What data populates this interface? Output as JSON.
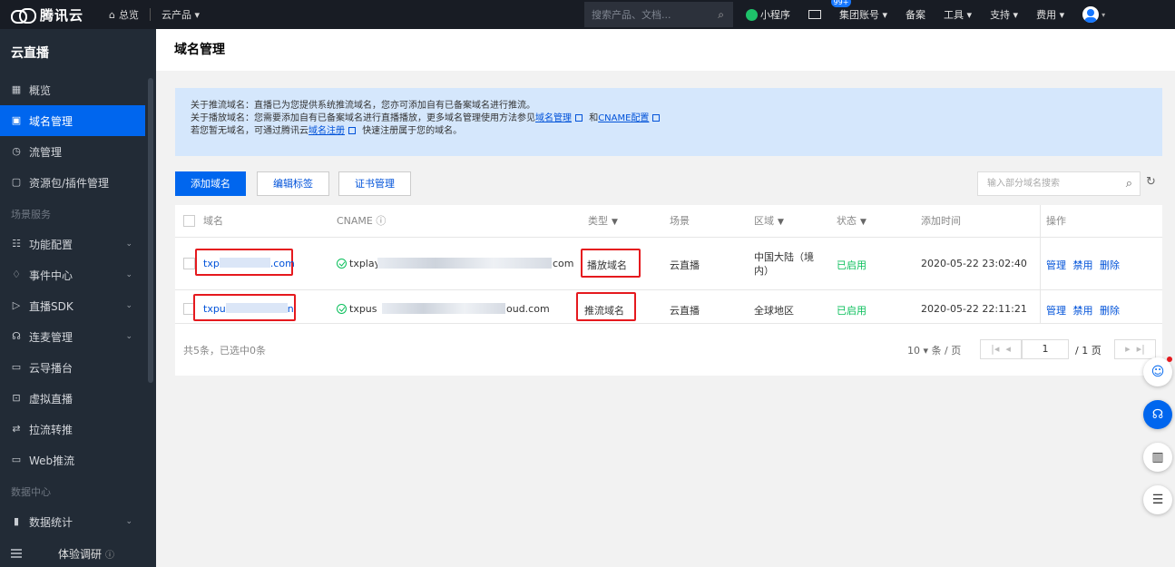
{
  "topbar": {
    "brand": "腾讯云",
    "home": "总览",
    "products": "云产品 ▾",
    "search_placeholder": "搜索产品、文档...",
    "mini_program": "小程序",
    "mail_badge": "99+",
    "group_account": "集团账号 ▾",
    "record": "备案",
    "tools": "工具 ▾",
    "support": "支持 ▾",
    "billing": "费用 ▾"
  },
  "sidebar": {
    "title": "云直播",
    "items": [
      {
        "label": "概览",
        "icon": "grid-icon"
      },
      {
        "label": "域名管理",
        "icon": "domain-icon"
      },
      {
        "label": "流管理",
        "icon": "stream-icon"
      },
      {
        "label": "资源包/插件管理",
        "icon": "package-icon"
      }
    ],
    "group1": "场景服务",
    "scene_items": [
      {
        "label": "功能配置",
        "icon": "settings-icon"
      },
      {
        "label": "事件中心",
        "icon": "bell-icon"
      },
      {
        "label": "直播SDK",
        "icon": "play-icon"
      },
      {
        "label": "连麦管理",
        "icon": "mic-icon"
      },
      {
        "label": "云导播台",
        "icon": "monitor-icon"
      },
      {
        "label": "虚拟直播",
        "icon": "virtual-icon"
      },
      {
        "label": "拉流转推",
        "icon": "swap-icon"
      },
      {
        "label": "Web推流",
        "icon": "web-icon"
      }
    ],
    "group2": "数据中心",
    "data_items": [
      {
        "label": "数据统计",
        "icon": "bar-chart-icon"
      }
    ],
    "bottom": "体验调研"
  },
  "page": {
    "title": "域名管理"
  },
  "notice": {
    "line1": "关于推流域名：直播已为您提供系统推流域名，您亦可添加自有已备案域名进行推流。",
    "line2_pre": "关于播放域名：您需要添加自有已备案域名进行直播播放，更多域名管理使用方法参见",
    "line2_link1": "域名管理",
    "line2_mid": "和",
    "line2_link2": "CNAME配置",
    "line3_pre": "若您暂无域名，可通过腾讯云",
    "line3_link": "域名注册",
    "line3_post": "快速注册属于您的域名。"
  },
  "toolbar": {
    "add": "添加域名",
    "edit_tags": "编辑标签",
    "cert": "证书管理",
    "search_placeholder": "输入部分域名搜索"
  },
  "table": {
    "headers": {
      "domain": "域名",
      "cname": "CNAME",
      "type": "类型",
      "scene": "场景",
      "region": "区域",
      "status": "状态",
      "added": "添加时间",
      "actions": "操作"
    },
    "rows": [
      {
        "domain_pre": "txp",
        "domain_post": ".com",
        "cname_pre": "txplay",
        "cname_post": "com",
        "type": "播放域名",
        "scene": "云直播",
        "region": "中国大陆（境内）",
        "status": "已启用",
        "added": "2020-05-22 23:02:40",
        "act_manage": "管理",
        "act_disable": "禁用",
        "act_delete": "删除"
      },
      {
        "domain_pre": "txpu",
        "domain_post": "n",
        "cname_pre": "txpus",
        "cname_post": "oud.com",
        "type": "推流域名",
        "scene": "云直播",
        "region": "全球地区",
        "status": "已启用",
        "added": "2020-05-22 22:11:21",
        "act_manage": "管理",
        "act_disable": "禁用",
        "act_delete": "删除"
      }
    ],
    "summary": "共5条，已选中0条",
    "page_size": "10 ▾ 条 / 页",
    "current_page": "1",
    "total_pages": "/ 1 页"
  },
  "colors": {
    "primary": "#0066ee",
    "link": "#0052d9",
    "status_green": "#0abf5b",
    "highlight_red": "#e5191e"
  }
}
